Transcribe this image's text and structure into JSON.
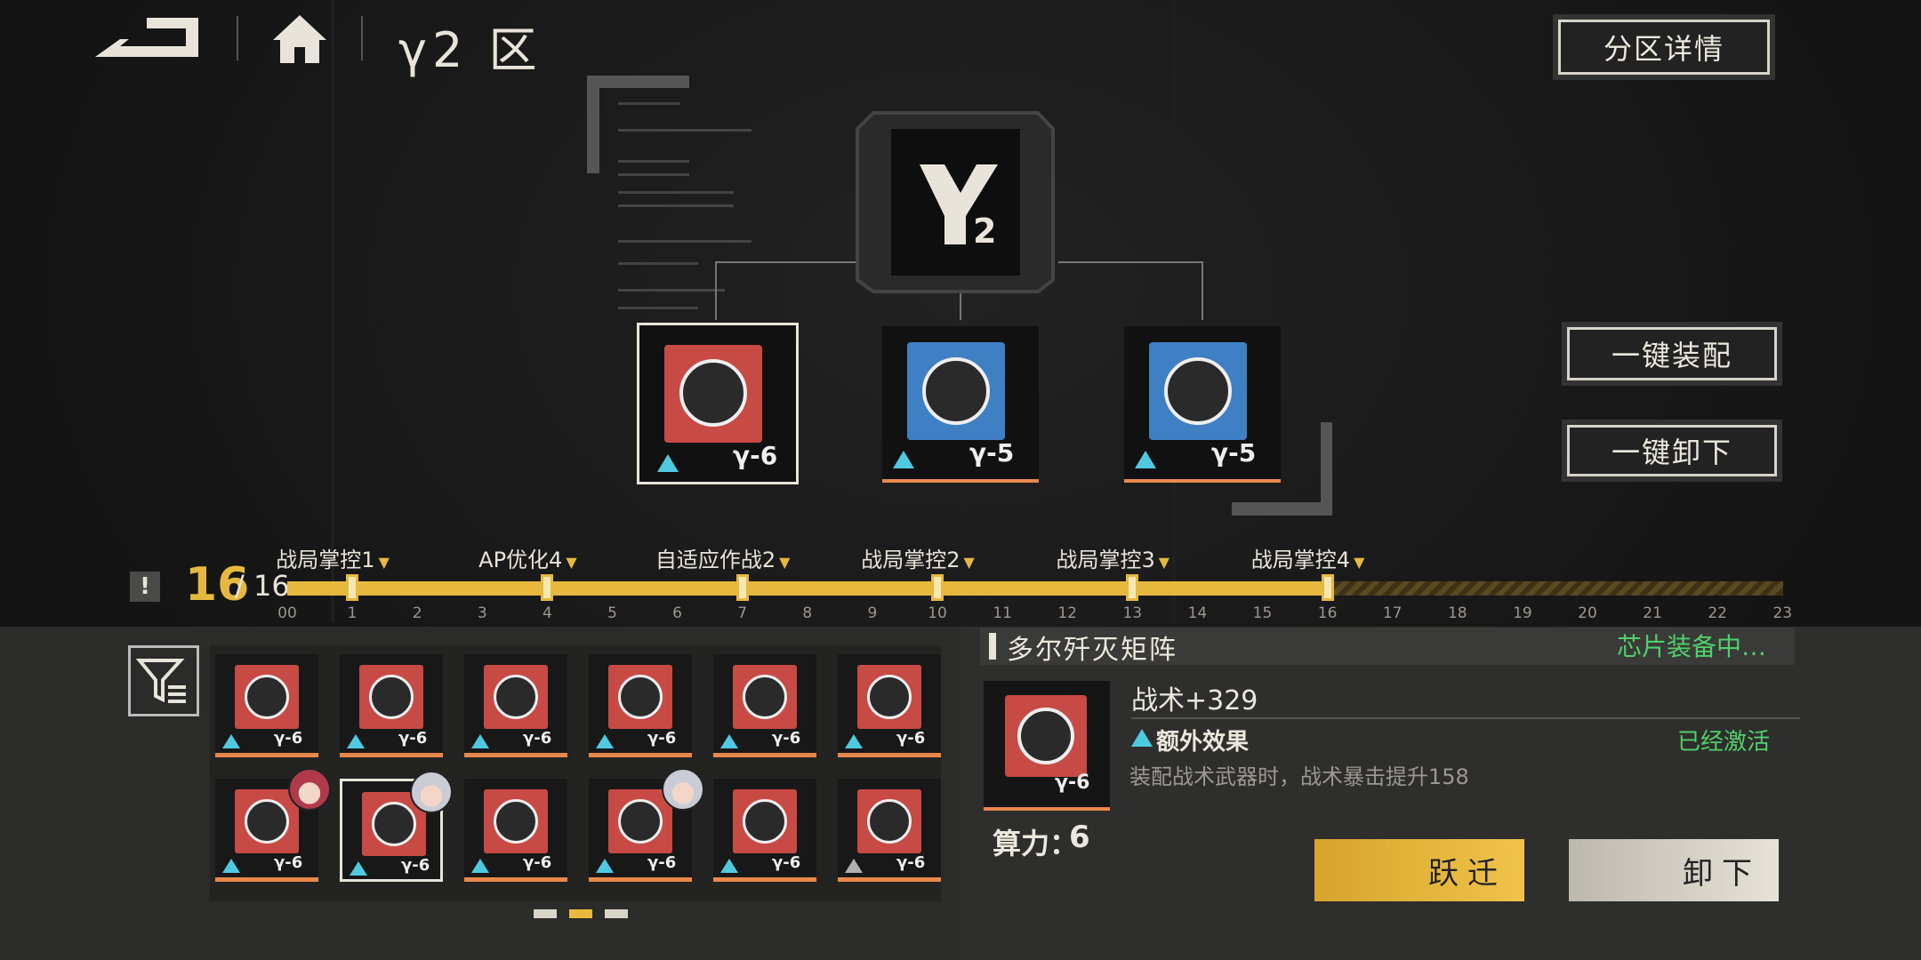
{
  "header": {
    "zone_title": "γ2 区",
    "zone_detail_button": "分区详情"
  },
  "side_buttons": {
    "equip_all": "一键装配",
    "unequip_all": "一键卸下"
  },
  "slots": [
    {
      "code": "γ-6",
      "color": "#c84a44"
    },
    {
      "code": "γ-5",
      "color": "#3f7fc4"
    },
    {
      "code": "γ-5",
      "color": "#3f7fc4"
    }
  ],
  "progress": {
    "current": "16",
    "total": "/ 16",
    "warning_icon": "!",
    "ticks": [
      "00",
      "1",
      "2",
      "3",
      "4",
      "5",
      "6",
      "7",
      "8",
      "9",
      "10",
      "11",
      "12",
      "13",
      "14",
      "15",
      "16",
      "17",
      "18",
      "19",
      "20",
      "21",
      "22",
      "23"
    ],
    "filled_to": 16,
    "milestones": [
      {
        "at": 1,
        "label": "战局掌控1"
      },
      {
        "at": 4,
        "label": "AP优化4"
      },
      {
        "at": 7,
        "label": "自适应作战2"
      },
      {
        "at": 10,
        "label": "战局掌控2"
      },
      {
        "at": 13,
        "label": "战局掌控3"
      },
      {
        "at": 16,
        "label": "战局掌控4"
      }
    ]
  },
  "inventory": {
    "chips": [
      {
        "code": "γ-6",
        "rarity": "cyan",
        "avatar": ""
      },
      {
        "code": "γ-6",
        "rarity": "cyan",
        "avatar": ""
      },
      {
        "code": "γ-6",
        "rarity": "cyan",
        "avatar": ""
      },
      {
        "code": "γ-6",
        "rarity": "cyan",
        "avatar": ""
      },
      {
        "code": "γ-6",
        "rarity": "cyan",
        "avatar": ""
      },
      {
        "code": "γ-6",
        "rarity": "cyan",
        "avatar": ""
      },
      {
        "code": "γ-6",
        "rarity": "cyan",
        "avatar": "red-hair"
      },
      {
        "code": "γ-6",
        "rarity": "cyan",
        "avatar": "silver-hair",
        "selected": true
      },
      {
        "code": "γ-6",
        "rarity": "cyan",
        "avatar": ""
      },
      {
        "code": "γ-6",
        "rarity": "cyan",
        "avatar": "silver-hair"
      },
      {
        "code": "γ-6",
        "rarity": "cyan",
        "avatar": ""
      },
      {
        "code": "γ-6",
        "rarity": "grey",
        "avatar": ""
      }
    ],
    "pages": 3,
    "active_page": 1
  },
  "detail": {
    "name": "多尔歼灭矩阵",
    "status": "芯片装备中…",
    "stat": "战术+329",
    "extra_title": "额外效果",
    "extra_status": "已经激活",
    "extra_desc": "装配战术武器时，战术暴击提升158",
    "power_label": "算力：",
    "power_value": "6",
    "chip_code": "γ-6",
    "transfer_button": "跃迁",
    "unequip_button": "卸下"
  },
  "colors": {
    "accent_yellow": "#e6b93e",
    "active_green": "#4fd06a",
    "chip_red": "#c84a44",
    "chip_blue": "#3f7fc4",
    "rarity_cyan": "#4ec9e0"
  }
}
